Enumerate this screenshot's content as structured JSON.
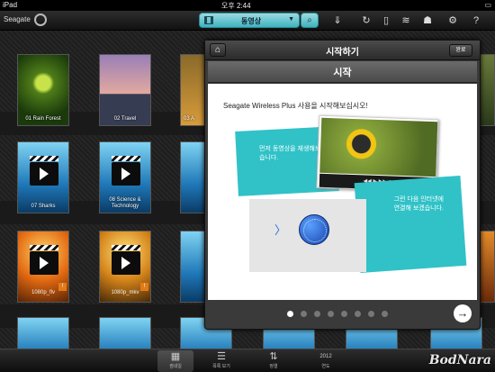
{
  "statusbar": {
    "carrier": "iPad",
    "time": "오후 2:44"
  },
  "app": {
    "logo": "Seagate"
  },
  "toolbar": {
    "media_type": "동영상",
    "caret": "▼",
    "icons": [
      "download-icon",
      "refresh-icon",
      "battery-icon",
      "wifi-icon",
      "users-icon",
      "gear-icon",
      "help-icon"
    ]
  },
  "tiles_row1": [
    {
      "title": "01 Rain Forest"
    },
    {
      "title": "02 Travel"
    },
    {
      "title": "03 A"
    }
  ],
  "tiles_row2": [
    {
      "title": "07 Sharks"
    },
    {
      "title": "08 Science & Technology"
    },
    {
      "title": ""
    }
  ],
  "tiles_row3": [
    {
      "title": "1080p_flv"
    },
    {
      "title": "1080p_mkv"
    },
    {
      "title": ""
    }
  ],
  "modal": {
    "title": "시작하기",
    "done": "완료",
    "section": "시작",
    "intro": "Seagate Wireless Plus 사용을 시작해보십시오!",
    "card1": "먼저 동영상을 재생해보겠습니다.",
    "card2": "그런 다음 인터넷에 연결해 보겠습니다.",
    "page_index": 1,
    "page_count": 8,
    "next": "→"
  },
  "tabbar": {
    "tabs": [
      {
        "label": "썸네일",
        "icon": "grid-icon",
        "active": true
      },
      {
        "label": "목록 보기",
        "icon": "list-icon",
        "active": false
      },
      {
        "label": "정렬",
        "icon": "sort-icon",
        "active": false
      },
      {
        "label": "연도",
        "icon": "calendar-icon",
        "active": false
      }
    ],
    "calendar_text": "2012"
  },
  "watermark": "BodNara",
  "colors": {
    "accent": "#30c2c7",
    "toolbar": "#3fb3bf"
  }
}
